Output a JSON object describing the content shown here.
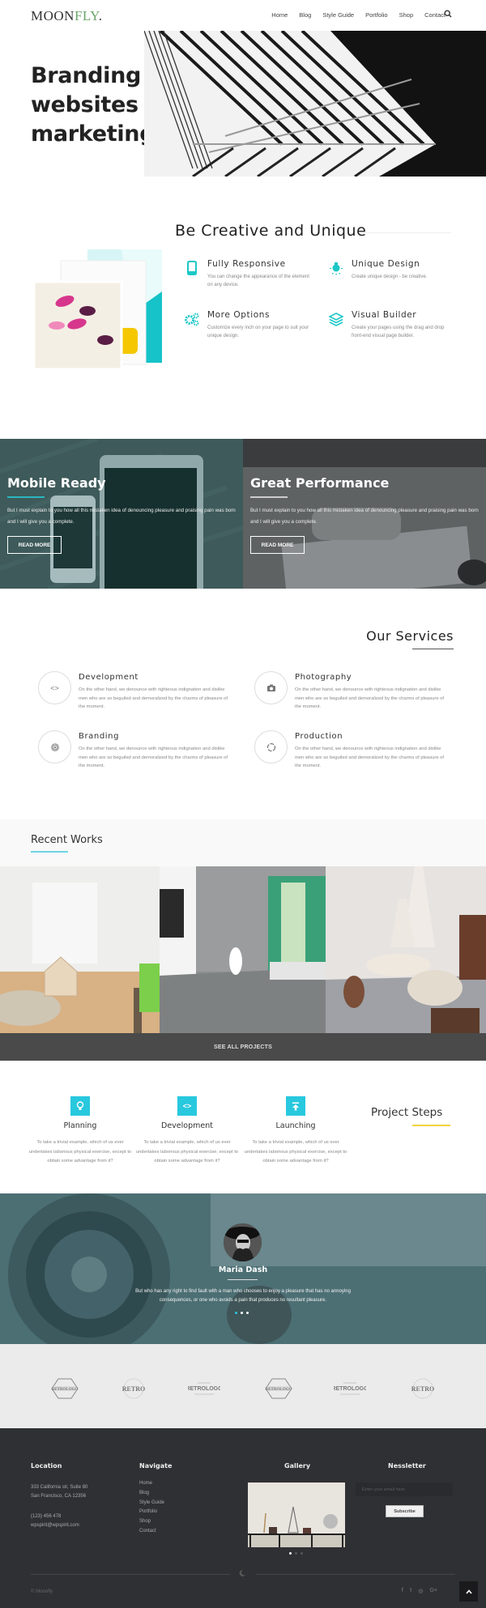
{
  "nav": {
    "logo_main": "MOON",
    "logo_accent": "FLY",
    "logo_dot": ".",
    "items": [
      "Home",
      "Blog",
      "Style Guide",
      "Portfolio",
      "Shop",
      "Contact"
    ],
    "search_icon": "search-icon"
  },
  "hero": {
    "lines": [
      "Branding",
      "websites",
      "marketing"
    ]
  },
  "creative": {
    "title": "Be Creative and Unique",
    "features": [
      {
        "icon": "tablet-icon",
        "title": "Fully Responsive",
        "text": "You can change the appearance of the element on any device."
      },
      {
        "icon": "lightbulb-icon",
        "title": "Unique Design",
        "text": "Create unique design - be creative."
      },
      {
        "icon": "gears-icon",
        "title": "More Options",
        "text": "Customize every inch on your page to suit your unique design."
      },
      {
        "icon": "layers-icon",
        "title": "Visual Builder",
        "text": "Create your pages using the drag and drop front-end visual page builder."
      }
    ],
    "accent_color": "#1cc7c7"
  },
  "banners": [
    {
      "title": "Mobile Ready",
      "text": "But I must explain to you how all this mistaken idea of denouncing pleasure and praising pain was born and I will give you a complete.",
      "button": "READ MORE",
      "line_color": "#2ab7c0"
    },
    {
      "title": "Great Performance",
      "text": "But I must explain to you how all this mistaken idea of denouncing pleasure and praising pain was born and I will give you a complete.",
      "button": "READ MORE",
      "line_color": "#cccccc"
    }
  ],
  "services": {
    "title": "Our Services",
    "items": [
      {
        "icon": "code-icon",
        "title": "Development",
        "text": "On the other hand, we denounce with righteous indignation and dislike men who are so beguiled and demoralized by the charms of pleasure of the moment."
      },
      {
        "icon": "camera-icon",
        "title": "Photography",
        "text": "On the other hand, we denounce with righteous indignation and dislike men who are so beguiled and demoralized by the charms of pleasure of the moment."
      },
      {
        "icon": "target-icon",
        "title": "Branding",
        "text": "On the other hand, we denounce with righteous indignation and dislike men who are so beguiled and demoralized by the charms of pleasure of the moment."
      },
      {
        "icon": "spinner-icon",
        "title": "Production",
        "text": "On the other hand, we denounce with righteous indignation and dislike men who are so beguiled and demoralized by the charms of pleasure of the moment."
      }
    ]
  },
  "works": {
    "title": "Recent Works",
    "see_all": "SEE ALL PROJECTS"
  },
  "steps": {
    "title": "Project Steps",
    "items": [
      {
        "icon": "lightbulb-icon",
        "title": "Planning",
        "text": "To take a trivial example, which of us ever undertakes laborious physical exercise, except to obtain some advantage from it?"
      },
      {
        "icon": "code-icon",
        "title": "Development",
        "text": "To take a trivial example, which of us ever undertakes laborious physical exercise, except to obtain some advantage from it?"
      },
      {
        "icon": "upload-icon",
        "title": "Launching",
        "text": "To take a trivial example, which of us ever undertakes laborious physical exercise, except to obtain some advantage from it?"
      }
    ],
    "accent_color": "#28c8de",
    "underline_color": "#f2d43a"
  },
  "testimonial": {
    "name": "Maria Dash",
    "quote": "But who has any right to find fault with a man who chooses to enjoy a pleasure that has no annoying consequences, or one who avoids a pain that produces no resultant pleasure.",
    "slides": 3,
    "active_slide": 1
  },
  "clients": [
    "RETROLOGO",
    "RETRO",
    "RETROLOGO",
    "RETROLOGO",
    "RETROLOGO",
    "RETRO"
  ],
  "footer": {
    "location": {
      "title": "Location",
      "address1": "333 California str, Suite 80",
      "address2": "San Francisco, CA 12356",
      "phone": "(123) 456 478",
      "email": "wpspirit@wpspirit.com"
    },
    "navigate": {
      "title": "Navigate",
      "links": [
        "Home",
        "Blog",
        "Style Guide",
        "Portfolio",
        "Shop",
        "Contact"
      ]
    },
    "gallery": {
      "title": "Gallery",
      "slides": 3,
      "active_slide": 1
    },
    "newsletter": {
      "title": "Nesslетter",
      "placeholder": "Enter your email here",
      "button": "Subscribe"
    },
    "copyright": "© Moonfly",
    "socials": [
      "facebook-icon",
      "twitter-icon",
      "dribbble-icon",
      "google-plus-icon"
    ]
  }
}
